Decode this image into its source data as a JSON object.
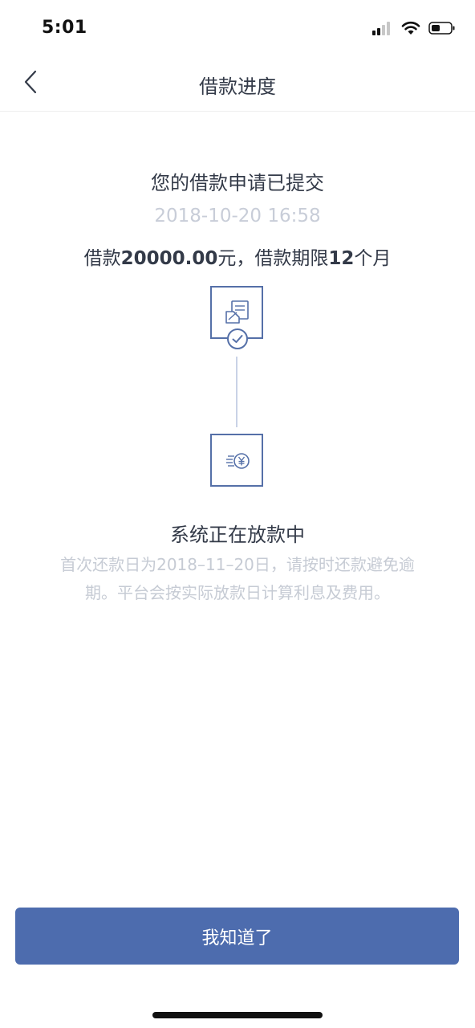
{
  "status_bar": {
    "time": "5:01",
    "icons": [
      "cellular-signal-icon",
      "wifi-icon",
      "battery-icon"
    ]
  },
  "nav": {
    "back_icon": "chevron-left-icon",
    "title": "借款进度"
  },
  "content": {
    "headline": "您的借款申请已提交",
    "timestamp": "2018-10-20 16:58",
    "summary": {
      "prefix": "借款",
      "amount": "20000.00",
      "middle": "元，借款期限",
      "term": "12",
      "suffix": "个月"
    },
    "steps": [
      {
        "icon": "document-icon",
        "status": "completed",
        "badge_icon": "check-circle-icon"
      },
      {
        "icon": "coins-yen-icon",
        "status": "in-progress"
      }
    ],
    "current_status": "系统正在放款中",
    "note": "首次还款日为2018–11–20日，请按时还款避免逾期。平台会按实际放款日计算利息及费用。"
  },
  "actions": {
    "confirm_label": "我知道了"
  },
  "colors": {
    "accent": "#4d6cae",
    "text_primary": "#333a48",
    "text_muted": "#c6cbd4",
    "line": "#c9d2e6"
  }
}
